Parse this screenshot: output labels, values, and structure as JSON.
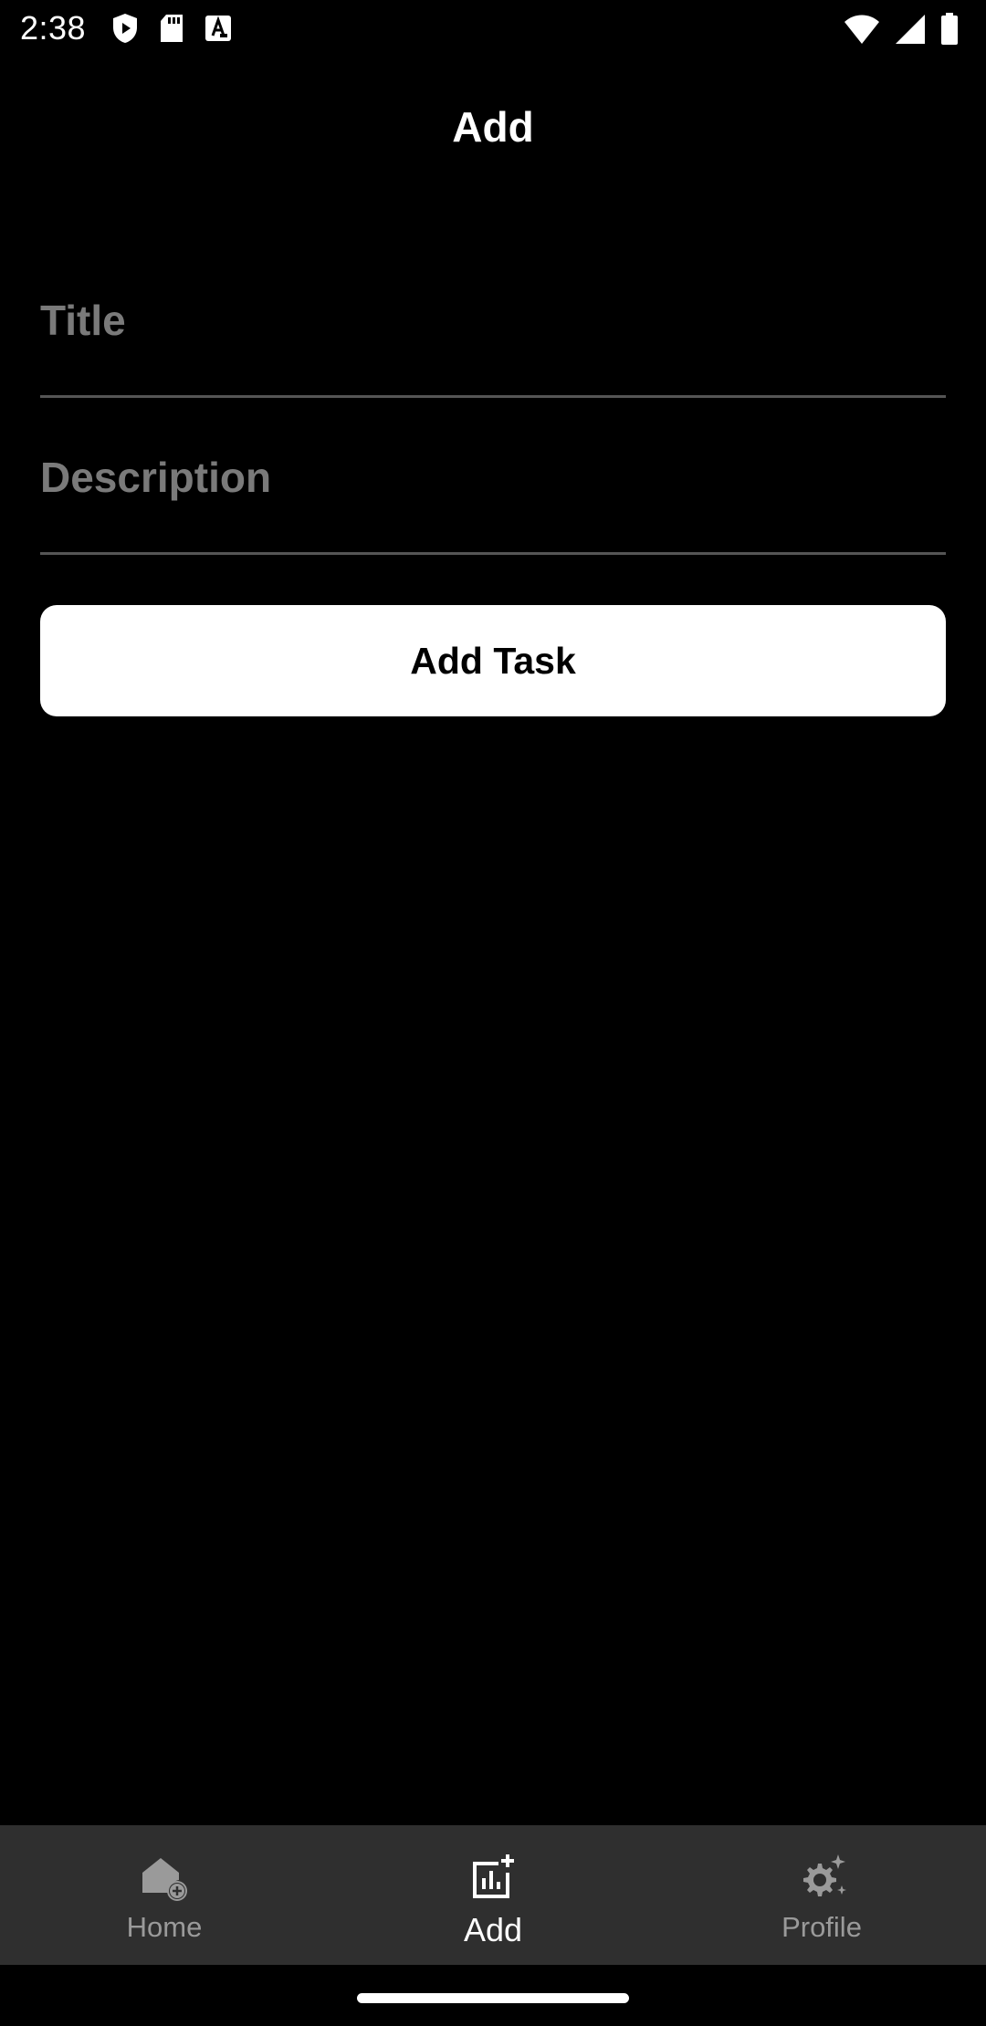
{
  "status_bar": {
    "time": "2:38",
    "left_icons": [
      "shield-play-icon",
      "sd-card-icon",
      "text-a-icon"
    ],
    "right_icons": [
      "wifi-icon",
      "cell-signal-icon",
      "battery-icon"
    ]
  },
  "header": {
    "title": "Add"
  },
  "form": {
    "title_field": {
      "value": "",
      "placeholder": "Title"
    },
    "description_field": {
      "value": "",
      "placeholder": "Description"
    },
    "submit_label": "Add Task"
  },
  "bottom_nav": {
    "items": [
      {
        "label": "Home",
        "icon": "home-add-icon",
        "active": false
      },
      {
        "label": "Add",
        "icon": "add-chart-icon",
        "active": true
      },
      {
        "label": "Profile",
        "icon": "settings-sparkle-icon",
        "active": false
      }
    ]
  },
  "colors": {
    "background": "#000000",
    "nav_background": "#2f2f2f",
    "placeholder": "#7a7a7a",
    "inactive_nav": "#9a9a9a",
    "button_bg": "#ffffff"
  }
}
